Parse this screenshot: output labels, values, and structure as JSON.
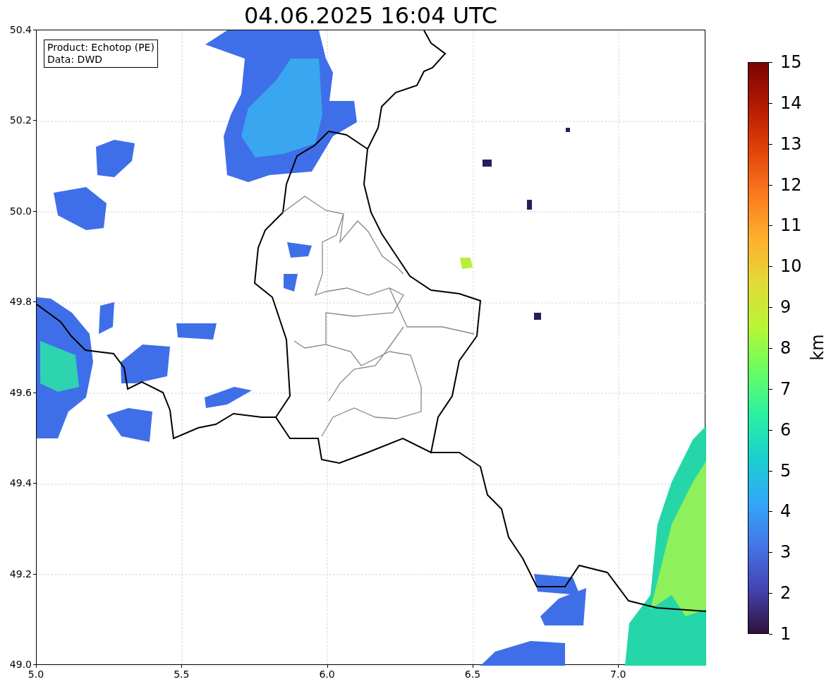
{
  "title": "04.06.2025 16:04 UTC",
  "legend": [
    "Product: Echotop (PE)",
    "Data: DWD"
  ],
  "x_ticks": [
    "5.0",
    "5.5",
    "6.0",
    "6.5",
    "7.0"
  ],
  "y_ticks": [
    "50.4",
    "50.2",
    "50.0",
    "49.8",
    "49.6",
    "49.4",
    "49.2",
    "49.0"
  ],
  "colorbar": {
    "label": "km",
    "ticks": [
      "15",
      "14",
      "13",
      "12",
      "11",
      "10",
      "9",
      "8",
      "7",
      "6",
      "5",
      "4",
      "3",
      "2",
      "1"
    ]
  }
}
